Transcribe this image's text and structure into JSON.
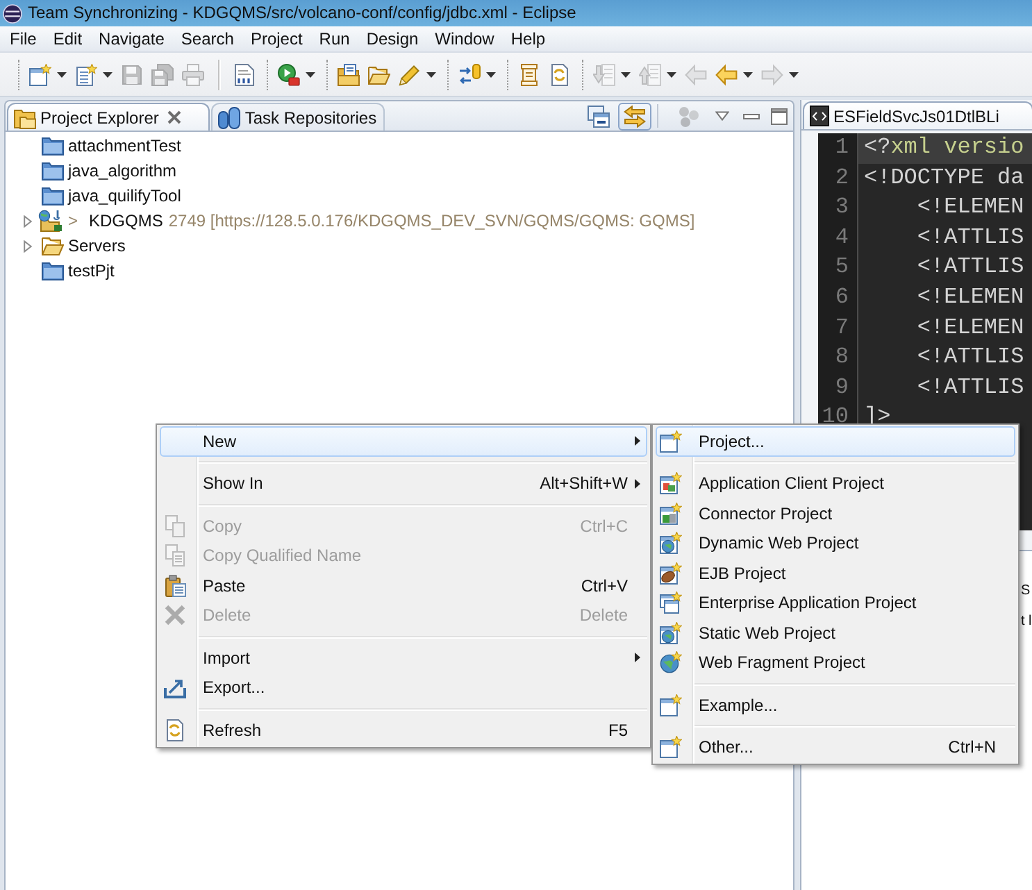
{
  "window": {
    "title": "Team Synchronizing - KDGQMS/src/volcano-conf/config/jdbc.xml - Eclipse"
  },
  "menu_bar": [
    "File",
    "Edit",
    "Navigate",
    "Search",
    "Project",
    "Run",
    "Design",
    "Window",
    "Help"
  ],
  "toolbar": [
    {
      "kind": "grip"
    },
    {
      "kind": "button",
      "disabled": false,
      "dropdown": true
    },
    {
      "kind": "button",
      "disabled": false,
      "dropdown": true
    },
    {
      "kind": "button",
      "disabled": true,
      "dropdown": false
    },
    {
      "kind": "button",
      "disabled": true,
      "dropdown": false
    },
    {
      "kind": "button",
      "disabled": true,
      "dropdown": false
    },
    {
      "kind": "separator"
    },
    {
      "kind": "button",
      "disabled": false,
      "dropdown": false
    },
    {
      "kind": "grip"
    },
    {
      "kind": "button",
      "disabled": false,
      "dropdown": true
    },
    {
      "kind": "grip"
    },
    {
      "kind": "button",
      "disabled": false,
      "dropdown": false
    },
    {
      "kind": "button",
      "disabled": false,
      "dropdown": false
    },
    {
      "kind": "button",
      "disabled": false,
      "dropdown": true
    },
    {
      "kind": "grip"
    },
    {
      "kind": "button",
      "disabled": false,
      "dropdown": true
    },
    {
      "kind": "grip"
    },
    {
      "kind": "button",
      "disabled": false,
      "dropdown": false
    },
    {
      "kind": "button",
      "disabled": false,
      "dropdown": false
    },
    {
      "kind": "grip"
    },
    {
      "kind": "button",
      "disabled": true,
      "dropdown": true
    },
    {
      "kind": "button",
      "disabled": true,
      "dropdown": true
    },
    {
      "kind": "button",
      "disabled": true,
      "dropdown": false
    },
    {
      "kind": "button",
      "disabled": false,
      "dropdown": true
    },
    {
      "kind": "button",
      "disabled": true,
      "dropdown": true
    }
  ],
  "explorer": {
    "tabs": [
      {
        "label": "Project Explorer",
        "selected": true,
        "closable": true
      },
      {
        "label": "Task Repositories",
        "selected": false,
        "closable": false
      }
    ],
    "view_toolbar": [
      {
        "selected": false,
        "disabled": false
      },
      {
        "selected": true,
        "disabled": false
      },
      {
        "selected": false,
        "disabled": true
      }
    ],
    "tree": [
      {
        "label": "attachmentTest",
        "kind": "project"
      },
      {
        "label": "java_algorithm",
        "kind": "project"
      },
      {
        "label": "java_quilifyTool",
        "kind": "project"
      },
      {
        "prefix": ">",
        "label": "KDGQMS",
        "decoration": "2749 [https://128.5.0.176/KDGQMS_DEV_SVN/GQMS/GQMS: GQMS]",
        "kind": "shared_project",
        "expanded": false
      },
      {
        "label": "Servers",
        "kind": "folder",
        "expanded": false
      },
      {
        "label": "testPjt",
        "kind": "project"
      }
    ]
  },
  "editor": {
    "tabs": [
      {
        "label": "ESFieldSvcJs01DtlBLi",
        "selected": true
      }
    ],
    "lines": [
      {
        "number": "1",
        "current": true,
        "tokens": [
          {
            "text": "<?",
            "kind": "markup"
          },
          {
            "text": "xml versio",
            "kind": "declaration"
          }
        ]
      },
      {
        "number": "2",
        "current": false,
        "tokens": [
          {
            "text": "<!DOCTYPE da",
            "kind": "markup"
          }
        ]
      },
      {
        "number": "3",
        "current": false,
        "tokens": [
          {
            "text": "    <!ELEMEN",
            "kind": "markup"
          }
        ]
      },
      {
        "number": "4",
        "current": false,
        "tokens": [
          {
            "text": "    <!ATTLIS",
            "kind": "markup"
          }
        ]
      },
      {
        "number": "5",
        "current": false,
        "tokens": [
          {
            "text": "    <!ATTLIS",
            "kind": "markup"
          }
        ]
      },
      {
        "number": "6",
        "current": false,
        "tokens": [
          {
            "text": "    <!ELEMEN",
            "kind": "markup"
          }
        ]
      },
      {
        "number": "7",
        "current": false,
        "tokens": [
          {
            "text": "    <!ELEMEN",
            "kind": "markup"
          }
        ]
      },
      {
        "number": "8",
        "current": false,
        "tokens": [
          {
            "text": "    <!ATTLIS",
            "kind": "markup"
          }
        ]
      },
      {
        "number": "9",
        "current": false,
        "tokens": [
          {
            "text": "    <!ATTLIS",
            "kind": "markup"
          }
        ]
      },
      {
        "number": "10",
        "current": false,
        "tokens": [
          {
            "text": "]>",
            "kind": "markup"
          }
        ]
      }
    ]
  },
  "lower_panel": {
    "tab": "S",
    "lines": [
      "t l"
    ]
  },
  "context_menu": {
    "groups": [
      {
        "items": [
          {
            "label": "New",
            "selected": true,
            "disabled": false,
            "submenu": true
          }
        ]
      },
      {
        "items": [
          {
            "label": "Show In",
            "shortcut": "Alt+Shift+W",
            "selected": false,
            "disabled": false,
            "submenu": true
          }
        ]
      },
      {
        "items": [
          {
            "label": "Copy",
            "shortcut": "Ctrl+C",
            "selected": false,
            "disabled": true,
            "submenu": false
          },
          {
            "label": "Copy Qualified Name",
            "selected": false,
            "disabled": true,
            "submenu": false
          },
          {
            "label": "Paste",
            "shortcut": "Ctrl+V",
            "selected": false,
            "disabled": false,
            "submenu": false
          },
          {
            "label": "Delete",
            "shortcut": "Delete",
            "selected": false,
            "disabled": true,
            "submenu": false
          }
        ]
      },
      {
        "items": [
          {
            "label": "Import",
            "selected": false,
            "disabled": false,
            "submenu": true
          },
          {
            "label": "Export...",
            "selected": false,
            "disabled": false,
            "submenu": false
          }
        ]
      },
      {
        "items": [
          {
            "label": "Refresh",
            "shortcut": "F5",
            "selected": false,
            "disabled": false,
            "submenu": false
          }
        ]
      }
    ]
  },
  "submenu": {
    "groups": [
      {
        "items": [
          {
            "label": "Project...",
            "selected": true
          }
        ]
      },
      {
        "items": [
          {
            "label": "Application Client Project",
            "selected": false
          },
          {
            "label": "Connector Project",
            "selected": false
          },
          {
            "label": "Dynamic Web Project",
            "selected": false
          },
          {
            "label": "EJB Project",
            "selected": false
          },
          {
            "label": "Enterprise Application Project",
            "selected": false
          },
          {
            "label": "Static Web Project",
            "selected": false
          },
          {
            "label": "Web Fragment Project",
            "selected": false
          }
        ]
      },
      {
        "items": [
          {
            "label": "Example...",
            "selected": false
          }
        ]
      },
      {
        "items": [
          {
            "label": "Other...",
            "shortcut": "Ctrl+N",
            "selected": false
          }
        ]
      }
    ]
  }
}
